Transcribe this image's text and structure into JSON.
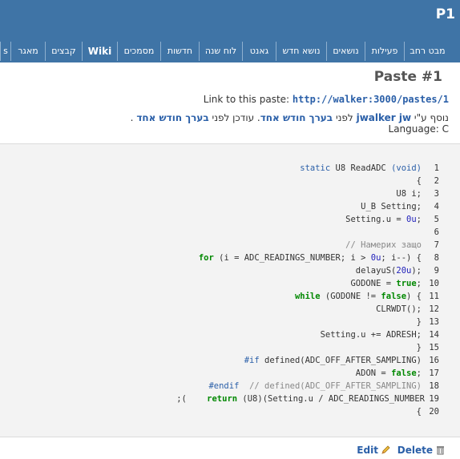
{
  "header": {
    "project_id": "P1"
  },
  "tabs": [
    {
      "label": "מבט רחב"
    },
    {
      "label": "פעילות"
    },
    {
      "label": "נושאים"
    },
    {
      "label": "נושא חדש"
    },
    {
      "label": "גאנט"
    },
    {
      "label": "לוח שנה"
    },
    {
      "label": "חדשות"
    },
    {
      "label": "מסמכים"
    },
    {
      "label": "Wiki"
    },
    {
      "label": "קבצים"
    },
    {
      "label": "מאגר"
    },
    {
      "label": "s"
    }
  ],
  "paste": {
    "title": "Paste #1",
    "link_label": "Link to this paste:",
    "link_url": "http://walker:3000/pastes/1",
    "info_prefix": "נוסף ע\"י",
    "author": "jwalker jw",
    "before_word": "לפני",
    "added_ago": "בערך חודש אחד",
    "updated_text": ". עודכן לפני",
    "updated_ago": "בערך חודש אחד",
    "end_dot": ".",
    "language_label": "Language:",
    "language_value": "C"
  },
  "code": {
    "line_numbers": [
      "1",
      "2",
      "3",
      "4",
      "5",
      "6",
      "7",
      "8",
      "9",
      "10",
      "11",
      "12",
      "13",
      "14",
      "15",
      "16",
      "17",
      "18",
      "19",
      "20"
    ],
    "lines": [
      "static U8 ReadADC (void)",
      "{",
      "U8 i;",
      "U_B Setting;",
      "Setting.u = 0u;",
      "",
      "// Намерих защо",
      "for (i = ADC_READINGS_NUMBER; i > 0u; i--) {",
      "delayuS(20u);",
      "GODONE = true;",
      "while (GODONE != false) {",
      "CLRWDT();",
      "}",
      "Setting.u += ADRESH;",
      "}",
      "#if defined(ADC_OFF_AFTER_SAMPLING)",
      "ADON = false;",
      "#endif  // defined(ADC_OFF_AFTER_SAMPLING)",
      "return (U8)(Setting.u / ADC_READINGS_NUMBER 19",
      "{"
    ],
    "line19_tail": ";(",
    "line19_main": "return (U8)(Setting.u / ADC_READINGS_NUMBER"
  },
  "actions": {
    "edit_label": "Edit",
    "delete_label": "Delete"
  }
}
